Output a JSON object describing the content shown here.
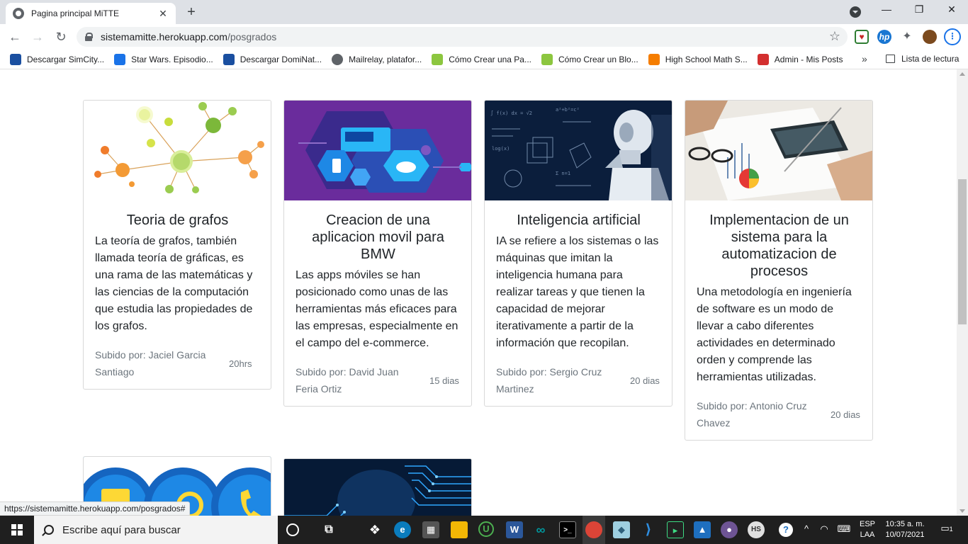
{
  "browser": {
    "tab_title": "Pagina principal MiTTE",
    "tab_close": "✕",
    "new_tab": "+",
    "url_host": "sistemamitte.herokuapp.com",
    "url_path": "/posgrados",
    "bookmarks": [
      {
        "label": "Descargar SimCity...",
        "color": "#1a4fa0",
        "glyph": "S"
      },
      {
        "label": "Star Wars. Episodio...",
        "color": "#1a73e8",
        "glyph": "▭"
      },
      {
        "label": "Descargar DomiNat...",
        "color": "#1a4fa0",
        "glyph": "S"
      },
      {
        "label": "Mailrelay, platafor...",
        "color": "#5f6368",
        "glyph": "◍"
      },
      {
        "label": "Cómo Crear una Pa...",
        "color": "#8cc63f",
        "glyph": "S"
      },
      {
        "label": "Cómo Crear un Blo...",
        "color": "#8cc63f",
        "glyph": "S"
      },
      {
        "label": "High School Math S...",
        "color": "#f57d00",
        "glyph": "B"
      },
      {
        "label": "Admin - Mis Posts",
        "color": "#d32f2f",
        "glyph": "✿"
      }
    ],
    "bookmarks_more": "»",
    "reading_list": "Lista de lectura",
    "status_url": "https://sistemamitte.herokuapp.com/posgrados#"
  },
  "cards": [
    {
      "title": "Teoria de grafos",
      "text": "La teoría de grafos, también llamada teoría de gráficas, es una rama de las matemáticas y las ciencias de la computación que estudia las propiedades de los grafos.",
      "author": "Subido por: Jaciel Garcia Santiago",
      "time": "20hrs"
    },
    {
      "title": "Creacion de una aplicacion movil para BMW",
      "text": "Las apps móviles se han posicionado como unas de las herramientas más eficaces para las empresas, especialmente en el campo del e-commerce.",
      "author": "Subido por: David Juan Feria Ortiz",
      "time": "15 dias"
    },
    {
      "title": "Inteligencia artificial",
      "text": "IA se refiere a los sistemas o las máquinas que imitan la inteligencia humana para realizar tareas y que tienen la capacidad de mejorar iterativamente a partir de la información que recopilan.",
      "author": "Subido por: Sergio Cruz Martinez",
      "time": "20 dias"
    },
    {
      "title": "Implementacion de un sistema para la automatizacion de procesos",
      "text": "Una metodología en ingeniería de software es un modo de llevar a cabo diferentes actividades en determinado orden y comprende las herramientas utilizadas.",
      "author": "Subido por: Antonio Cruz Chavez",
      "time": "20 dias"
    }
  ],
  "taskbar": {
    "search_placeholder": "Escribe aquí para buscar",
    "lang_top": "ESP",
    "lang_bottom": "LAA",
    "time": "10:35 a. m.",
    "date": "10/07/2021",
    "notifications": "1"
  }
}
